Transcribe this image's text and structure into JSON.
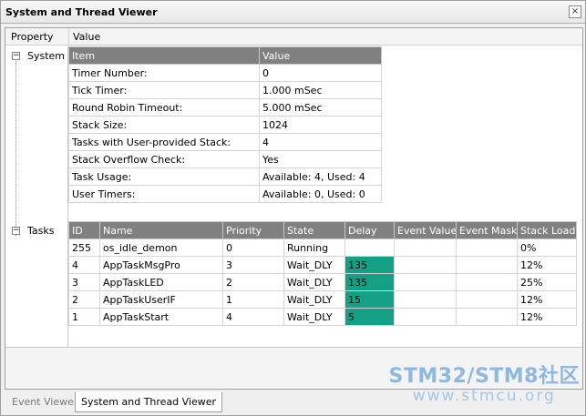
{
  "window": {
    "title": "System and Thread Viewer",
    "close_glyph": "×"
  },
  "columns": {
    "property": "Property",
    "value": "Value"
  },
  "tree": {
    "system": {
      "label": "System",
      "expander": "−"
    },
    "tasks": {
      "label": "Tasks",
      "expander": "−"
    }
  },
  "system_table": {
    "headers": [
      "Item",
      "Value"
    ],
    "rows": [
      [
        "Timer Number:",
        "0"
      ],
      [
        "Tick Timer:",
        "1.000 mSec"
      ],
      [
        "Round Robin Timeout:",
        "5.000 mSec"
      ],
      [
        "Stack Size:",
        "1024"
      ],
      [
        "Tasks with User-provided Stack:",
        "4"
      ],
      [
        "Stack Overflow Check:",
        "Yes"
      ],
      [
        "Task Usage:",
        "Available: 4, Used: 4"
      ],
      [
        "User Timers:",
        "Available: 0, Used: 0"
      ]
    ]
  },
  "tasks_table": {
    "headers": [
      "ID",
      "Name",
      "Priority",
      "State",
      "Delay",
      "Event Value",
      "Event Mask",
      "Stack Load"
    ],
    "rows": [
      [
        "255",
        "os_idle_demon",
        "0",
        "Running",
        "",
        "",
        "",
        "0%"
      ],
      [
        "4",
        "AppTaskMsgPro",
        "3",
        "Wait_DLY",
        "135",
        "",
        "",
        "12%"
      ],
      [
        "3",
        "AppTaskLED",
        "2",
        "Wait_DLY",
        "135",
        "",
        "",
        "25%"
      ],
      [
        "2",
        "AppTaskUserIF",
        "1",
        "Wait_DLY",
        "15",
        "",
        "",
        "12%"
      ],
      [
        "1",
        "AppTaskStart",
        "4",
        "Wait_DLY",
        "5",
        "",
        "",
        "12%"
      ]
    ],
    "delay_highlight_color": "#13a085"
  },
  "tabs": [
    {
      "label": "Event Viewer",
      "active": false
    },
    {
      "label": "System and Thread Viewer",
      "active": true
    }
  ],
  "watermark": {
    "title": "STM32/STM8社区",
    "url": "www.stmcu.org"
  }
}
